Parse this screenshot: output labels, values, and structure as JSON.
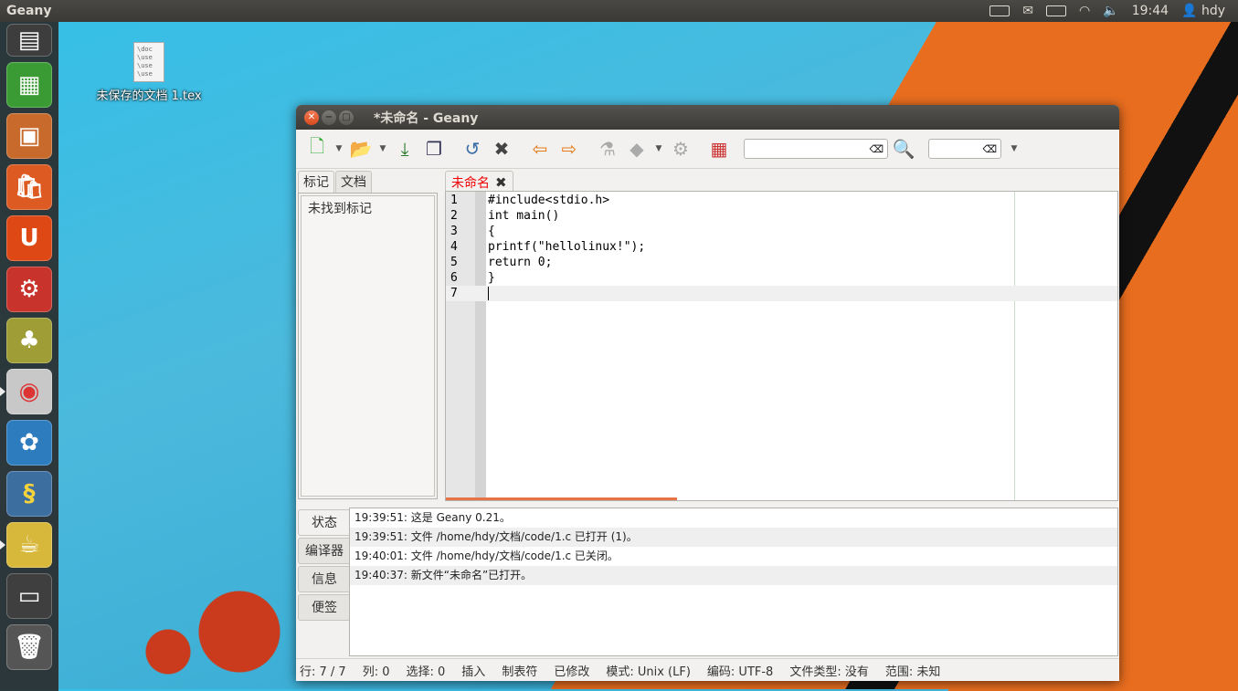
{
  "top_panel": {
    "app_title": "Geany",
    "time": "19:44",
    "user": "hdy"
  },
  "desktop": {
    "file_label": "未保存的文档 1.tex",
    "file_preview": "\\doc\n\\use\n\\use\n\\use"
  },
  "window": {
    "title": "*未命名 - Geany"
  },
  "sidebar": {
    "tabs": [
      "标记",
      "文档"
    ],
    "empty_text": "未找到标记"
  },
  "editor": {
    "tab_label": "未命名",
    "lines": [
      {
        "num": "1",
        "code": "#include<stdio.h>"
      },
      {
        "num": "2",
        "code": "int main()"
      },
      {
        "num": "3",
        "code": "{"
      },
      {
        "num": "4",
        "code": "printf(\"hellolinux!\");"
      },
      {
        "num": "5",
        "code": "return 0;"
      },
      {
        "num": "6",
        "code": "}"
      },
      {
        "num": "7",
        "code": ""
      }
    ]
  },
  "messages": {
    "tabs": [
      "状态",
      "编译器",
      "信息",
      "便签"
    ],
    "lines": [
      "19:39:51: 这是 Geany 0.21。",
      "19:39:51: 文件 /home/hdy/文档/code/1.c 已打开 (1)。",
      "19:40:01: 文件 /home/hdy/文档/code/1.c 已关闭。",
      "19:40:37: 新文件“未命名”已打开。"
    ]
  },
  "statusbar": {
    "line": "行: 7 / 7",
    "col": "列: 0",
    "sel": "选择: 0",
    "mode": "插入",
    "indent": "制表符",
    "modified": "已修改",
    "eol": "模式: Unix (LF)",
    "encoding": "编码: UTF-8",
    "filetype": "文件类型: 没有",
    "scope": "范围: 未知"
  },
  "colors": {
    "accent_orange": "#e67245",
    "modified_tab": "#e00000"
  }
}
